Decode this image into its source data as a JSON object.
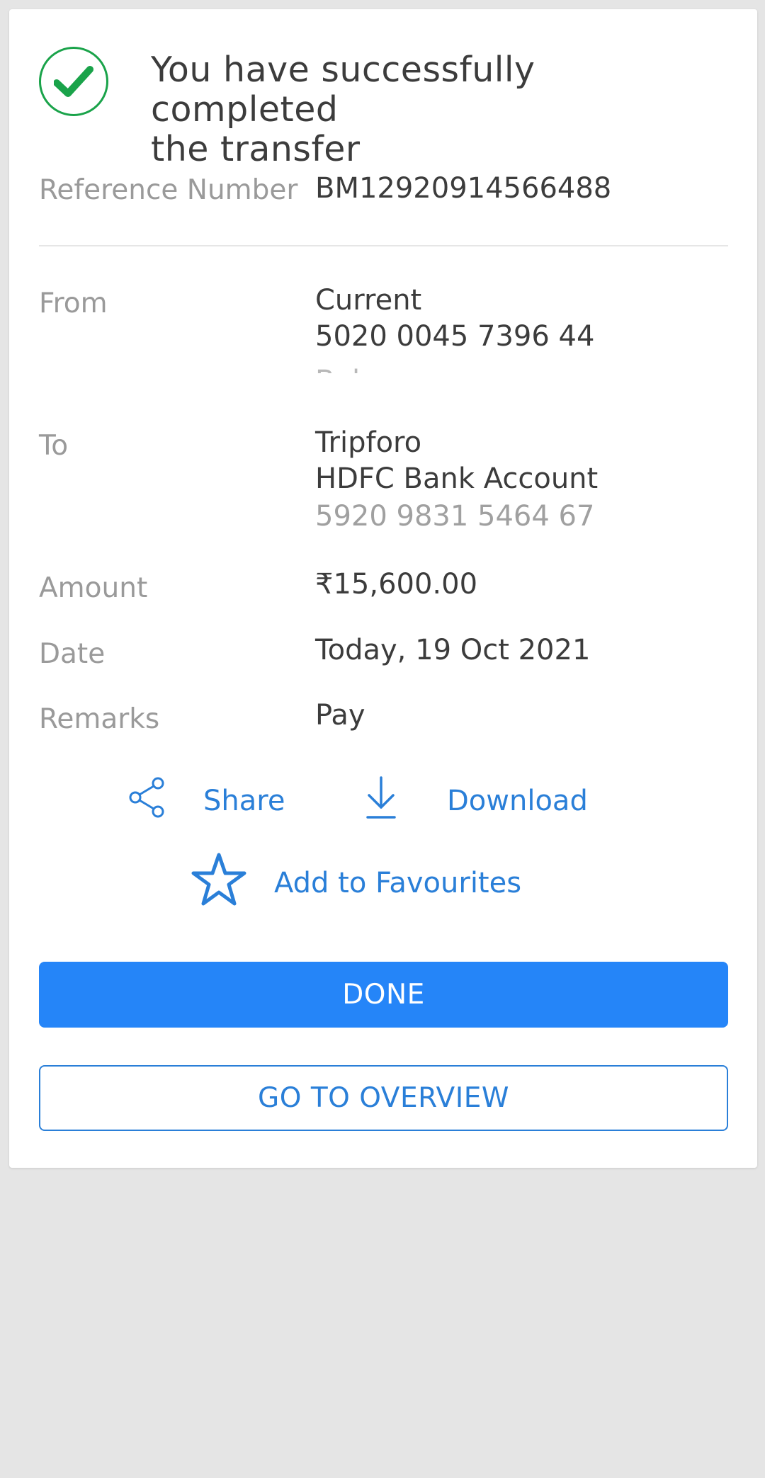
{
  "header": {
    "title_line1": "You have successfully completed",
    "title_line2": "the transfer"
  },
  "reference": {
    "label": "Reference Number",
    "value": "BM12920914566488"
  },
  "from": {
    "label": "From",
    "account_type": "Current",
    "account_number": "5020 0045 7396 44",
    "balance_clipped": "Bal"
  },
  "to": {
    "label": "To",
    "name": "Tripforo",
    "bank": "HDFC Bank Account",
    "account_number": "5920 9831 5464 67"
  },
  "amount": {
    "label": "Amount",
    "value": "₹15,600.00"
  },
  "date": {
    "label": "Date",
    "value": "Today, 19 Oct 2021"
  },
  "remarks": {
    "label": "Remarks",
    "value": "Pay"
  },
  "actions": {
    "share": "Share",
    "download": "Download",
    "favourites": "Add to Favourites"
  },
  "buttons": {
    "done": "DONE",
    "overview": "GO TO OVERVIEW"
  },
  "colors": {
    "accent": "#2585f8",
    "link": "#2a7fd8",
    "success": "#1aa34a"
  },
  "icons": [
    "check-circle-icon",
    "share-icon",
    "download-icon",
    "star-icon"
  ]
}
